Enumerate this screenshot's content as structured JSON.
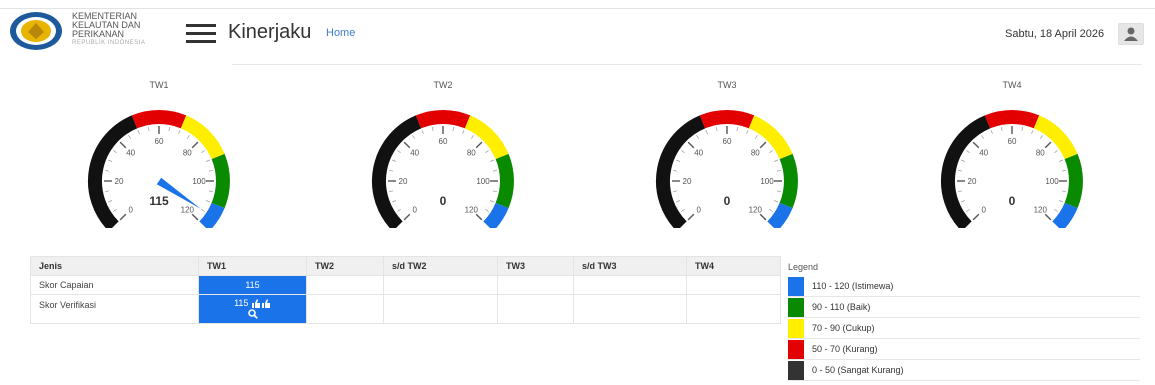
{
  "header": {
    "ministry_line1": "KEMENTERIAN",
    "ministry_line2": "KELAUTAN DAN",
    "ministry_line3": "PERIKANAN",
    "ministry_sub": "REPUBLIK INDONESIA",
    "app_title": "Kinerjaku",
    "home_link": "Home",
    "date": "Sabtu, 18 April 2026",
    "menu_icon": "hamburger-icon",
    "user_icon": "user-icon"
  },
  "gauges": [
    {
      "title": "TW1",
      "value": "115",
      "needle": 115
    },
    {
      "title": "TW2",
      "value": "0",
      "needle": null
    },
    {
      "title": "TW3",
      "value": "0",
      "needle": null
    },
    {
      "title": "TW4",
      "value": "0",
      "needle": null
    }
  ],
  "gauge_scale": {
    "min": 0,
    "max": 120,
    "tick_labels": [
      "0",
      "20",
      "40",
      "60",
      "80",
      "100",
      "120"
    ],
    "bands": [
      {
        "from": 0,
        "to": 50,
        "color": "#111111"
      },
      {
        "from": 50,
        "to": 70,
        "color": "#e30000"
      },
      {
        "from": 70,
        "to": 90,
        "color": "#ffee00"
      },
      {
        "from": 90,
        "to": 110,
        "color": "#0a8a00"
      },
      {
        "from": 110,
        "to": 120,
        "color": "#1a73e8"
      }
    ]
  },
  "table": {
    "headers": [
      "Jenis",
      "TW1",
      "TW2",
      "s/d TW2",
      "TW3",
      "s/d TW3",
      "TW4"
    ],
    "row1_label": "Skor Capaian",
    "row1_tw1": "115",
    "row2_label": "Skor Verifikasi",
    "row2_tw1": "115",
    "thumbs_icon": "thumbs-up-icon",
    "search_icon": "search-icon"
  },
  "legend": {
    "title": "Legend",
    "items": [
      {
        "label": "110 - 120 (Istimewa)",
        "color": "#1a73e8"
      },
      {
        "label": "90 - 110 (Baik)",
        "color": "#0a8a00"
      },
      {
        "label": "70 - 90 (Cukup)",
        "color": "#ffee00"
      },
      {
        "label": "50 - 70 (Kurang)",
        "color": "#e30000"
      },
      {
        "label": "0 - 50 (Sangat Kurang)",
        "color": "#333333"
      }
    ]
  }
}
